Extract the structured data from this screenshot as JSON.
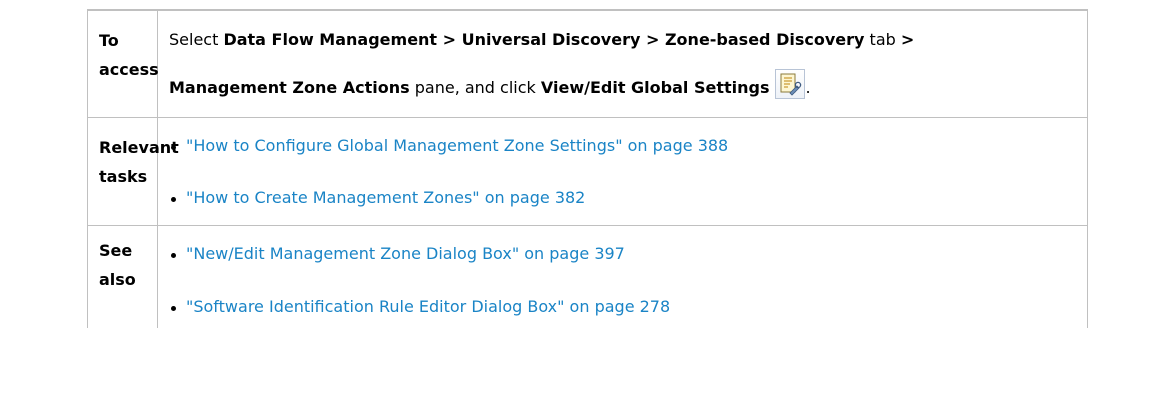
{
  "rows": {
    "access": {
      "label": "To access",
      "line1": {
        "t1": "Select ",
        "b1": "Data Flow Management > Universal Discovery > Zone-based Discovery",
        "t2": " tab ",
        "b2": ">"
      },
      "line2": {
        "b1": "Management Zone Actions",
        "t1": " pane, and click ",
        "b2": "View/Edit Global Settings",
        "t2": "."
      },
      "icon": "view-edit-global-settings-icon"
    },
    "relevant": {
      "label": "Relevant tasks",
      "links": [
        "\"How to Configure Global Management Zone Settings\" on page 388",
        "\"How to Create Management Zones\" on page 382"
      ]
    },
    "see_also": {
      "label": "See also",
      "links": [
        "\"New/Edit Management Zone Dialog Box\" on page 397",
        "\"Software Identification Rule Editor Dialog Box\" on page 278"
      ]
    }
  },
  "colors": {
    "link": "#1a84c6",
    "border": "#c0c0c0",
    "text": "#000000"
  }
}
